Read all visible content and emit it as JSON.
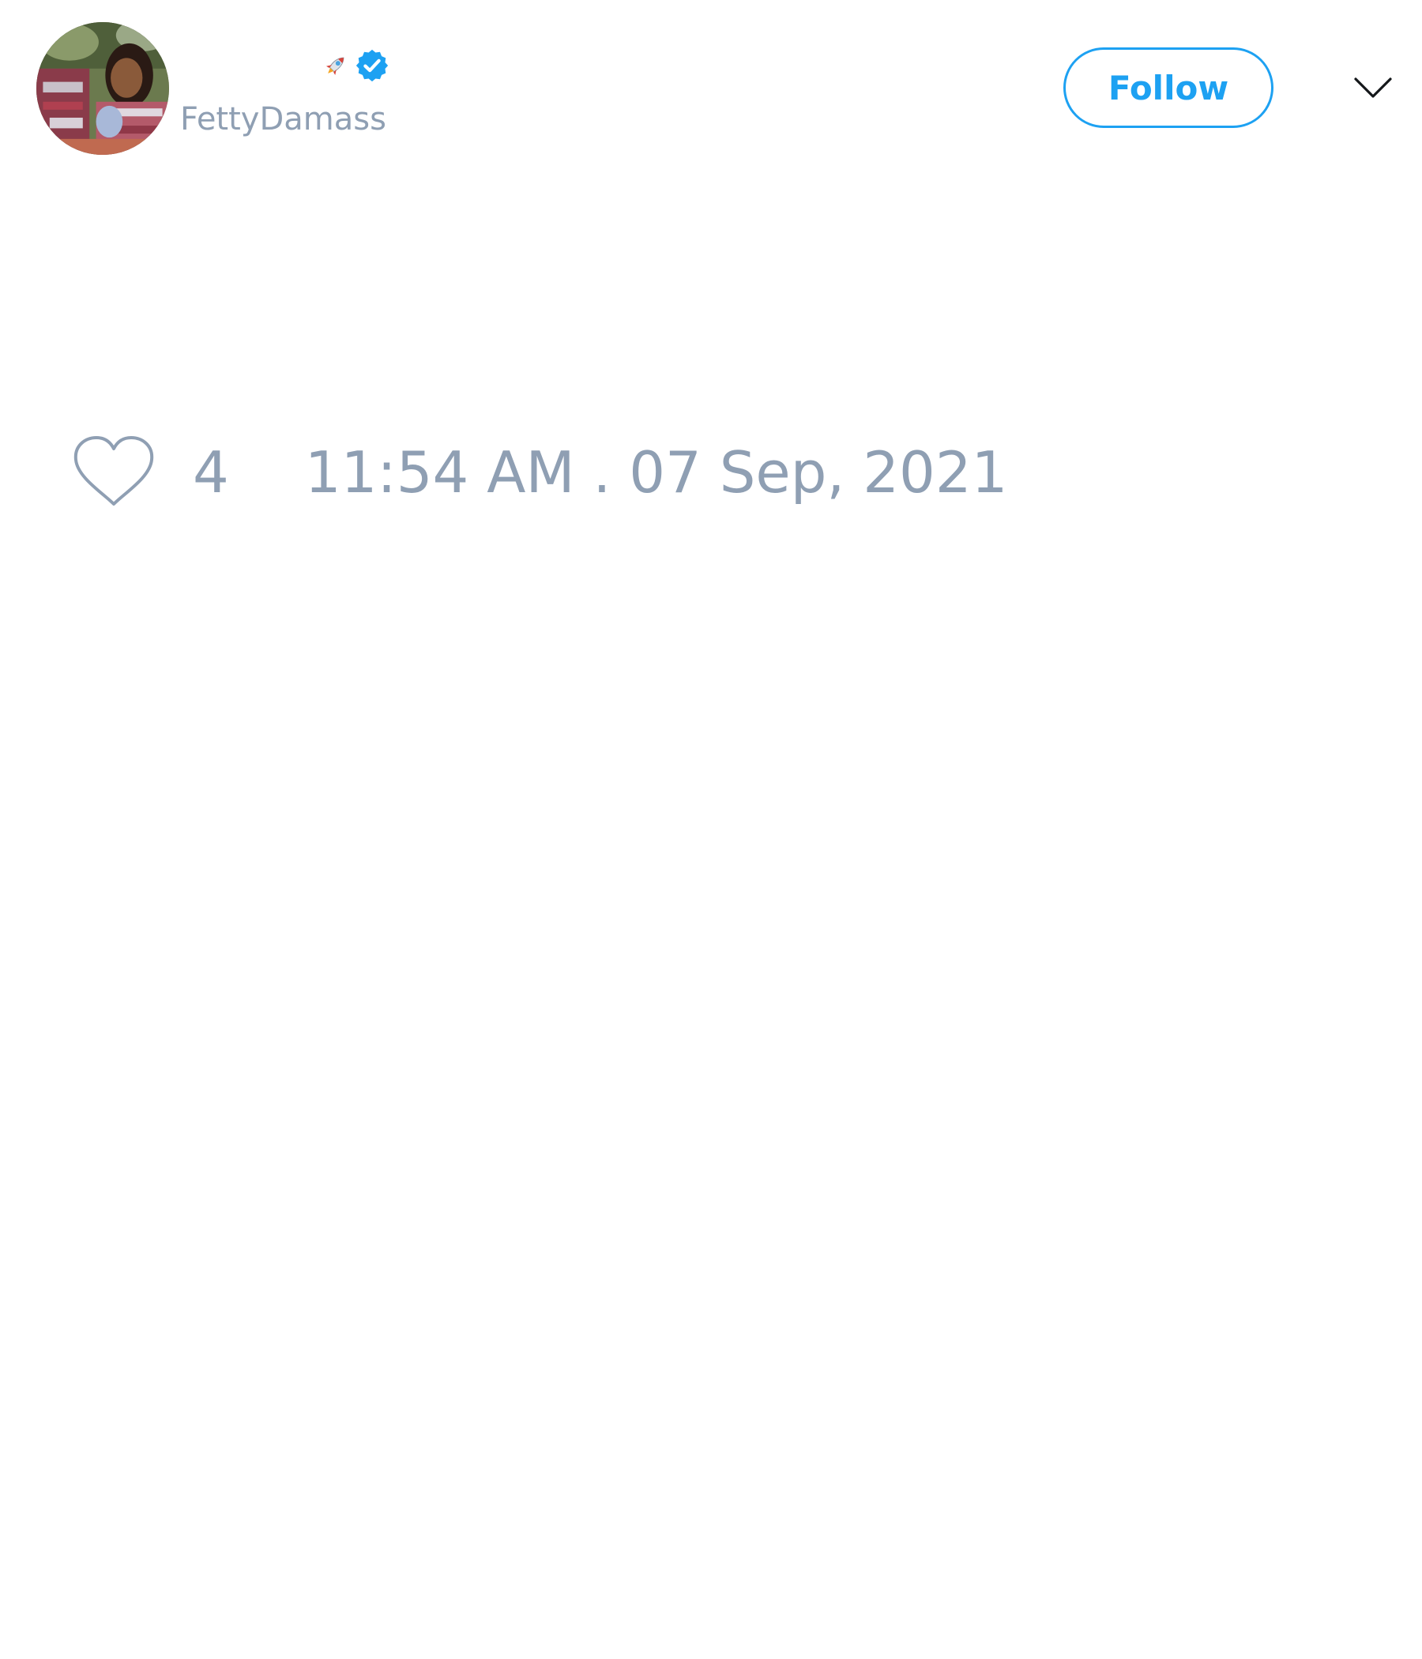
{
  "tweet": {
    "author": {
      "display_name": "",
      "handle": "FettyDamass",
      "avatar_icon": "profile-photo",
      "name_emoji_icon": "rocket-icon",
      "verified_icon": "verified-badge-icon",
      "verified": true
    },
    "follow_label": "Follow",
    "menu_icon": "chevron-down-icon",
    "like_icon": "heart-icon",
    "like_count": "4",
    "timestamp": "11:54 AM . 07 Sep, 2021"
  },
  "colors": {
    "accent": "#1da1f2",
    "muted_text": "#8f9fb3",
    "background": "#ffffff"
  }
}
